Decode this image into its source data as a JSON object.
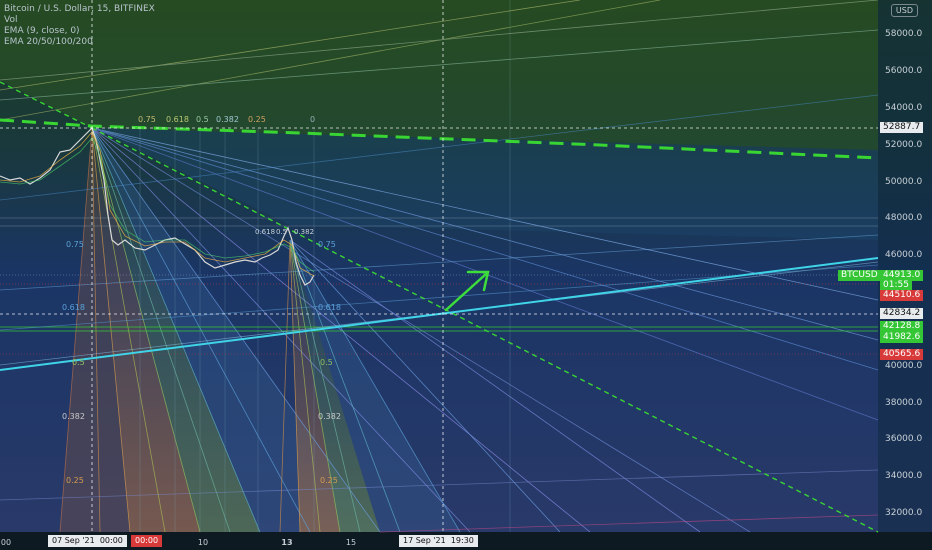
{
  "legend": {
    "title": "Bitcoin / U.S. Dollar, 15, BITFINEX",
    "vol": "Vol",
    "ema1": "EMA (9, close, 0)",
    "ema2": "EMA 20/50/100/200"
  },
  "currency": "USD",
  "price_ticks": [
    "58000.0",
    "56000.0",
    "54000.0",
    "52000.0",
    "50000.0",
    "48000.0",
    "46000.0",
    "40000.0",
    "38000.0",
    "36000.0",
    "34000.0",
    "32000.0"
  ],
  "price_badges": {
    "crosshair": "52887.7",
    "symbol": "BTCUSD",
    "last": "44913.0",
    "countdown": "01:55",
    "red1": "44510.6",
    "white": "42834.2",
    "green1": "42128.8",
    "green2": "41982.6",
    "red2": "40565.6"
  },
  "fib_labels_top": [
    "0.75",
    "0.618",
    "0.5",
    "0.382",
    "0.25",
    "0"
  ],
  "fib_labels_left": [
    "0.75",
    "0.618",
    "0.5",
    "0.382",
    "0.25"
  ],
  "fib_labels_right": [
    "0.75",
    "0.618",
    "0.5",
    "0.382",
    "0.25"
  ],
  "mini_fib_labels": [
    "0.618",
    "0.5",
    "0.382"
  ],
  "time_labels": [
    "00",
    "10",
    "13",
    "15"
  ],
  "time_badges": {
    "date1": "07 Sep '21",
    "time1": "00:00",
    "red": "00:00",
    "date2": "17 Sep '21",
    "time2": "19:30"
  },
  "colors": {
    "green_line": "#39d633",
    "cyan_line": "#3fd4e8",
    "arrow": "#3bde3b",
    "red_badge": "#d83a3a",
    "green_badge": "#35c635",
    "bg_top": "#1c3d24",
    "bg_bottom": "#1b2f5c"
  }
}
